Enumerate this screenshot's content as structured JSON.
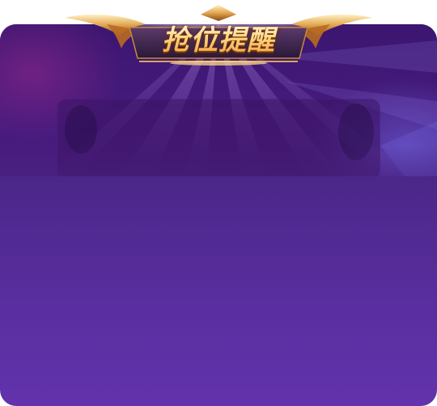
{
  "dialog": {
    "title": "抢位提醒"
  },
  "colors": {
    "panel_top": "#46237d",
    "panel_bottom": "#6233ac",
    "hero_bg": "#3c1670",
    "title_gold": "#ffd37a"
  }
}
